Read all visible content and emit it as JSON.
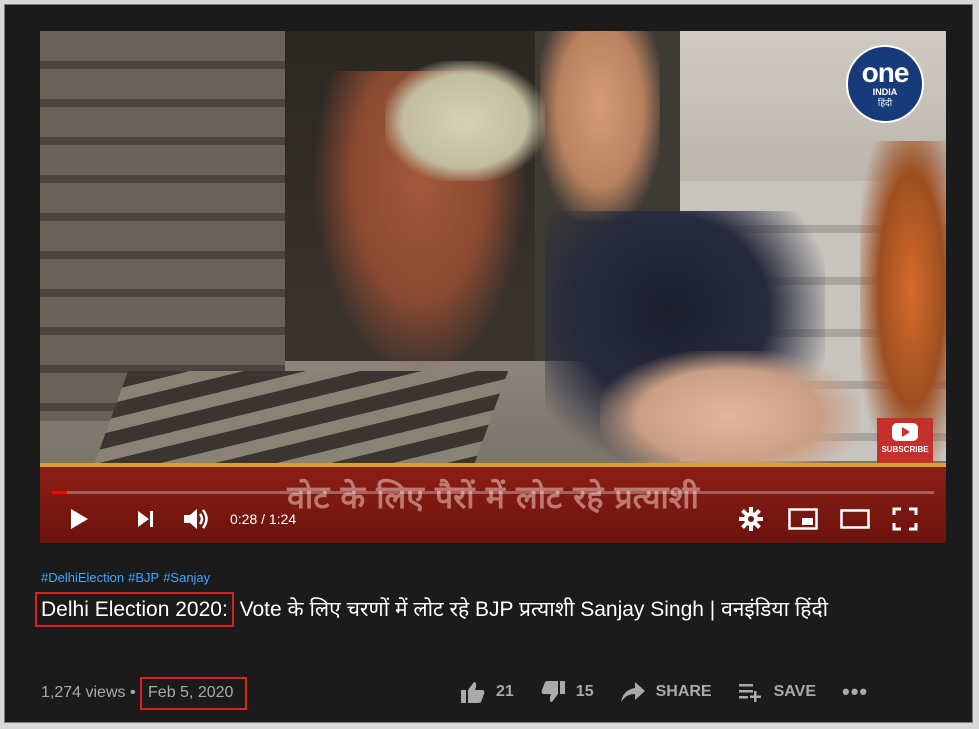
{
  "video": {
    "logo": {
      "main": "one",
      "sub": "INDIA",
      "lang": "हिंदी"
    },
    "subscribe_label": "SUBSCRIBE",
    "ticker_text": "वोट के लिए पैरों में लोट रहे प्रत्याशी",
    "time_current": "0:28",
    "time_total": "1:24",
    "progress_fraction": 0.017,
    "accent_color": "#ff0000"
  },
  "meta": {
    "hashtags": [
      "#DelhiElection",
      "#BJP",
      "#Sanjay"
    ],
    "title_highlight": "Delhi Election 2020:",
    "title_rest": " Vote के लिए चरणों में लोट रहे BJP प्रत्याशी Sanjay Singh | वनइंडिया हिंदी",
    "views": "1,274 views",
    "separator": "•",
    "date": "Feb 5, 2020",
    "highlight_color": "#e02020"
  },
  "actions": {
    "like_count": "21",
    "dislike_count": "15",
    "share_label": "SHARE",
    "save_label": "SAVE",
    "more_label": "•••"
  }
}
